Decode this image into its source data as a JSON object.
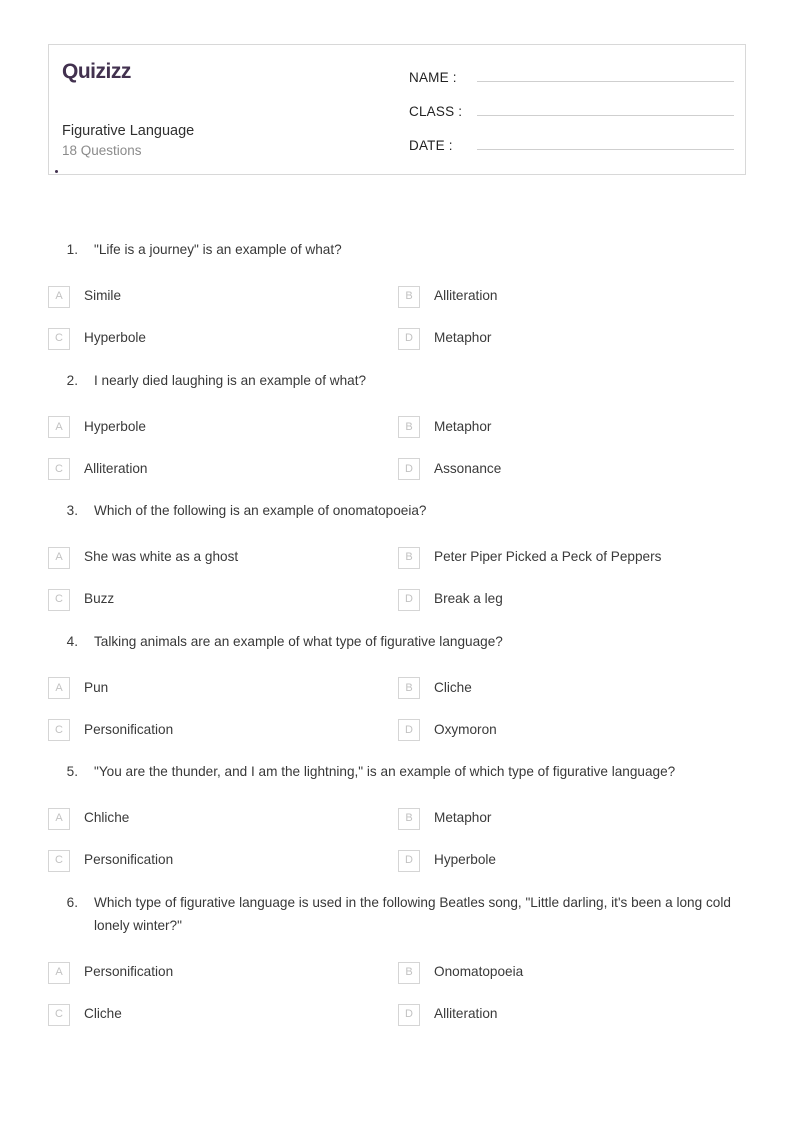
{
  "header": {
    "logo_text": "Quizizz",
    "logo_color": "#42314f",
    "quiz_title": "Figurative Language",
    "question_count_label": "18 Questions",
    "fields": [
      {
        "label": "NAME :",
        "value": ""
      },
      {
        "label": "CLASS :",
        "value": ""
      },
      {
        "label": "DATE  :",
        "value": ""
      }
    ]
  },
  "questions": [
    {
      "number": "1.",
      "text": "\"Life is a journey\" is an example of what?",
      "options": [
        {
          "letter": "A",
          "text": "Simile"
        },
        {
          "letter": "B",
          "text": "Alliteration"
        },
        {
          "letter": "C",
          "text": "Hyperbole"
        },
        {
          "letter": "D",
          "text": "Metaphor"
        }
      ]
    },
    {
      "number": "2.",
      "text": "I nearly died laughing is an example of what?",
      "options": [
        {
          "letter": "A",
          "text": "Hyperbole"
        },
        {
          "letter": "B",
          "text": "Metaphor"
        },
        {
          "letter": "C",
          "text": "Alliteration"
        },
        {
          "letter": "D",
          "text": "Assonance"
        }
      ]
    },
    {
      "number": "3.",
      "text": "Which of the following is an example of onomatopoeia?",
      "options": [
        {
          "letter": "A",
          "text": "She was white as a ghost"
        },
        {
          "letter": "B",
          "text": "Peter Piper Picked a Peck of Peppers"
        },
        {
          "letter": "C",
          "text": "Buzz"
        },
        {
          "letter": "D",
          "text": "Break a leg"
        }
      ]
    },
    {
      "number": "4.",
      "text": "Talking animals are an example of what type of figurative language?",
      "options": [
        {
          "letter": "A",
          "text": "Pun"
        },
        {
          "letter": "B",
          "text": "Cliche"
        },
        {
          "letter": "C",
          "text": "Personification"
        },
        {
          "letter": "D",
          "text": "Oxymoron"
        }
      ]
    },
    {
      "number": "5.",
      "text": "\"You are the thunder, and I am the lightning,\" is an example of which type of figurative language?",
      "options": [
        {
          "letter": "A",
          "text": "Chliche"
        },
        {
          "letter": "B",
          "text": "Metaphor"
        },
        {
          "letter": "C",
          "text": "Personification"
        },
        {
          "letter": "D",
          "text": "Hyperbole"
        }
      ]
    },
    {
      "number": "6.",
      "text": "Which type of figurative language is used in the following Beatles song, \"Little darling, it's been a long cold lonely winter?\"",
      "options": [
        {
          "letter": "A",
          "text": "Personification"
        },
        {
          "letter": "B",
          "text": "Onomatopoeia"
        },
        {
          "letter": "C",
          "text": "Cliche"
        },
        {
          "letter": "D",
          "text": "Alliteration"
        }
      ]
    }
  ]
}
